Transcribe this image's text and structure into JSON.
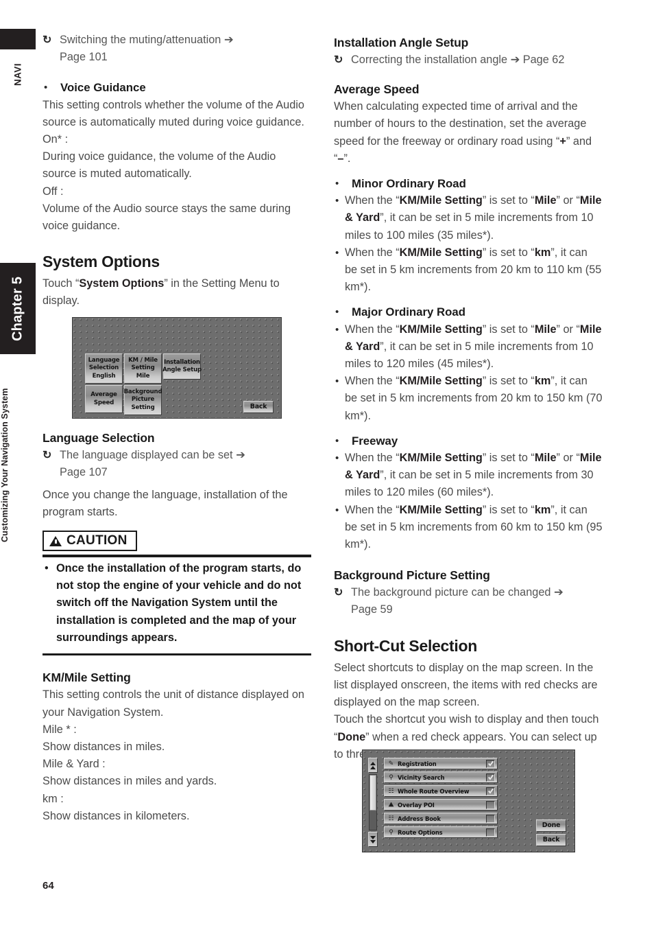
{
  "sidebar": {
    "navi_tab": "NAVI",
    "chapter": "Chapter 5",
    "section": "Customizing Your Navigation System"
  },
  "page_number": "64",
  "left_column": {
    "top_reference": {
      "loop_icon": "loop-arrow-icon",
      "line1": "Switching the muting/attenuation ➔",
      "line2": "Page 101"
    },
    "voice_guidance": {
      "bullet_heading": "Voice Guidance",
      "description": "This setting controls whether the volume of the Audio source is automatically muted during voice guidance.",
      "on_label": "On* :",
      "on_text": "During voice guidance, the volume of the Audio source is muted automatically.",
      "off_label": "Off :",
      "off_text": "Volume of the Audio source stays the same during voice guidance."
    },
    "system_options": {
      "title": "System Options",
      "intro_pre": "Touch “",
      "intro_bold": "System Options",
      "intro_post": "” in the Setting Menu to display.",
      "figure": {
        "name": "system-options-screen",
        "buttons": [
          {
            "lines": [
              "Language",
              "Selection",
              "English"
            ]
          },
          {
            "lines": [
              "KM / Mile",
              "Setting",
              "Mile"
            ]
          },
          {
            "lines": [
              "Installation",
              "Angle Setup"
            ]
          },
          {
            "lines": [
              "Average",
              "Speed"
            ]
          },
          {
            "lines": [
              "Background",
              "Picture",
              "Setting"
            ]
          }
        ],
        "back_label": "Back"
      }
    },
    "language_selection": {
      "heading": "Language Selection",
      "reference_line1": "The language displayed can be set ➔",
      "reference_line2": "Page 107",
      "body": "Once you change the language, installation of the program starts."
    },
    "caution": {
      "label": "CAUTION",
      "icon": "warning-triangle-icon",
      "text": "Once the installation of the program starts, do not stop the engine of your vehicle and do not switch off the Navigation System until the installation is completed and the map of your surroundings appears."
    },
    "km_mile_setting": {
      "heading": "KM/Mile Setting",
      "description": "This setting controls the unit of distance displayed on your Navigation System.",
      "items": [
        {
          "label": "Mile * :",
          "text": "Show distances in miles."
        },
        {
          "label": "Mile & Yard :",
          "text": "Show distances in miles and yards."
        },
        {
          "label": "km :",
          "text": "Show distances in kilometers."
        }
      ]
    }
  },
  "right_column": {
    "installation_angle": {
      "heading": "Installation Angle Setup",
      "reference": "Correcting the installation angle ➔ Page 62"
    },
    "average_speed": {
      "heading": "Average Speed",
      "intro_a": "When calculating expected time of arrival and the number of hours to the destination, set the average speed for the freeway or ordinary road using “",
      "intro_plus": "+",
      "intro_b": "” and “",
      "intro_minus": "–",
      "intro_c": "”.",
      "groups": [
        {
          "heading": "Minor Ordinary Road",
          "bullets": [
            {
              "pre": "When the “",
              "b1": "KM/Mile Setting",
              "mid1": "” is set to “",
              "b2": "Mile",
              "mid2": "” or “",
              "b3": "Mile & Yard",
              "post": "”, it can be set in 5 mile increments from 10 miles to 100 miles (35 miles*)."
            },
            {
              "pre": "When the “",
              "b1": "KM/Mile Setting",
              "mid1": "” is set to “",
              "b2": "km",
              "post": "”, it can be set in 5 km increments from 20 km to 110 km (55 km*)."
            }
          ]
        },
        {
          "heading": "Major Ordinary Road",
          "bullets": [
            {
              "pre": "When the “",
              "b1": "KM/Mile Setting",
              "mid1": "” is set to “",
              "b2": "Mile",
              "mid2": "” or “",
              "b3": "Mile & Yard",
              "post": "”, it can be set in 5 mile increments from 10 miles to 120 miles (45 miles*)."
            },
            {
              "pre": "When the “",
              "b1": "KM/Mile Setting",
              "mid1": "” is set to “",
              "b2": "km",
              "post": "”, it can be set in 5 km increments from 20 km to 150 km (70 km*)."
            }
          ]
        },
        {
          "heading": "Freeway",
          "bullets": [
            {
              "pre": "When the “",
              "b1": "KM/Mile Setting",
              "mid1": "” is set to “",
              "b2": "Mile",
              "mid2": "” or “",
              "b3": "Mile & Yard",
              "post": "”, it can be set in 5 mile increments from 30 miles to 120 miles (60 miles*)."
            },
            {
              "pre": "When the “",
              "b1": "KM/Mile Setting",
              "mid1": "” is set to “",
              "b2": "km",
              "post": "”, it can be set in 5 km increments from 60 km to 150 km (95 km*)."
            }
          ]
        }
      ]
    },
    "background_picture": {
      "heading": "Background Picture Setting",
      "reference_line1": "The background picture can be changed ➔",
      "reference_line2": "Page 59"
    },
    "short_cut_selection": {
      "title": "Short-Cut Selection",
      "body_a": "Select shortcuts to display on the map screen. In the list displayed onscreen, the items with red checks are displayed on the map screen.",
      "body_b_pre": "Touch the shortcut you wish to display and then touch “",
      "body_b_bold": "Done",
      "body_b_post": "” when a red check appears. You can select up to three shortcuts.",
      "figure": {
        "name": "short-cut-selection-screen",
        "rows": [
          {
            "icon": "registration-icon",
            "label": "Registration",
            "checked": true
          },
          {
            "icon": "vicinity-search-icon",
            "label": "Vicinity Search",
            "checked": true
          },
          {
            "icon": "whole-route-overview-icon",
            "label": "Whole Route Overview",
            "checked": true
          },
          {
            "icon": "overlay-poi-icon",
            "label": "Overlay POI",
            "checked": false
          },
          {
            "icon": "address-book-icon",
            "label": "Address Book",
            "checked": false
          },
          {
            "icon": "route-options-icon",
            "label": "Route Options",
            "checked": false
          }
        ],
        "done_label": "Done",
        "back_label": "Back"
      }
    }
  }
}
